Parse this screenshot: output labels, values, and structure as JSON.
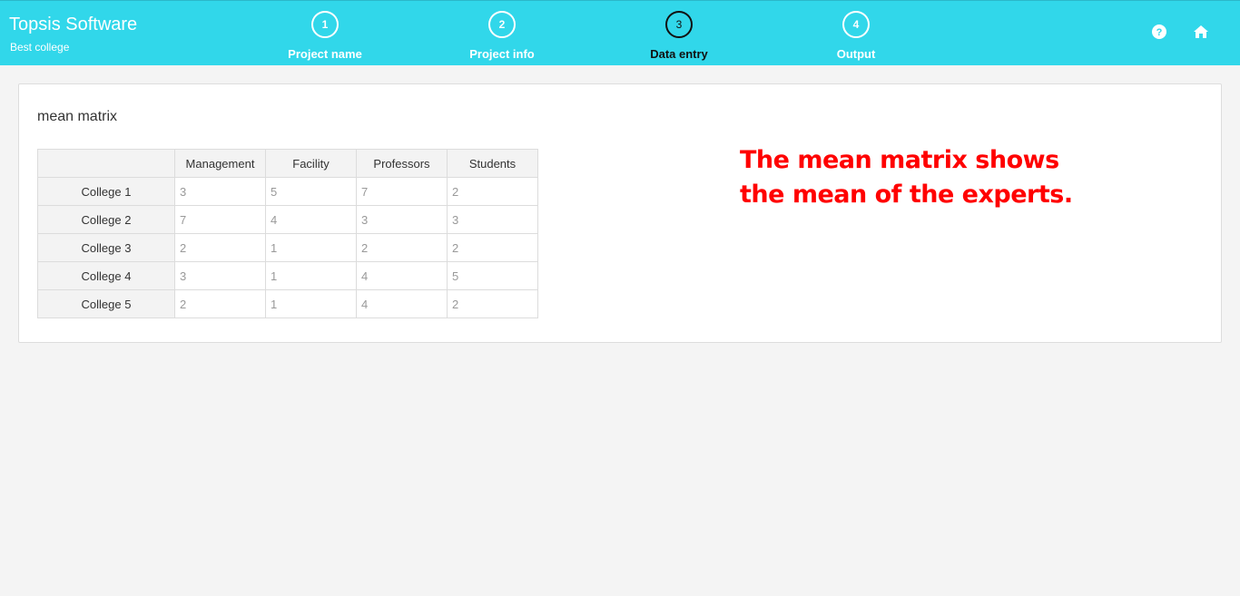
{
  "app": {
    "title": "Topsis Software",
    "project": "Best college"
  },
  "steps": [
    {
      "number": "1",
      "label": "Project name",
      "active": false
    },
    {
      "number": "2",
      "label": "Project info",
      "active": false
    },
    {
      "number": "3",
      "label": "Data entry",
      "active": true
    },
    {
      "number": "4",
      "label": "Output",
      "active": false
    }
  ],
  "header_icons": [
    {
      "name": "help-icon"
    },
    {
      "name": "home-icon"
    }
  ],
  "matrix": {
    "title": "mean matrix",
    "columns": [
      "Management",
      "Facility",
      "Professors",
      "Students"
    ],
    "rows": [
      {
        "label": "College 1",
        "values": [
          "3",
          "5",
          "7",
          "2"
        ]
      },
      {
        "label": "College 2",
        "values": [
          "7",
          "4",
          "3",
          "3"
        ]
      },
      {
        "label": "College 3",
        "values": [
          "2",
          "1",
          "2",
          "2"
        ]
      },
      {
        "label": "College 4",
        "values": [
          "3",
          "1",
          "4",
          "5"
        ]
      },
      {
        "label": "College 5",
        "values": [
          "2",
          "1",
          "4",
          "2"
        ]
      }
    ]
  },
  "annotation": {
    "line1": "The mean matrix shows",
    "line2": "the mean of the experts."
  },
  "colors": {
    "header": "#31d7ea",
    "annotation": "#ff0000"
  }
}
